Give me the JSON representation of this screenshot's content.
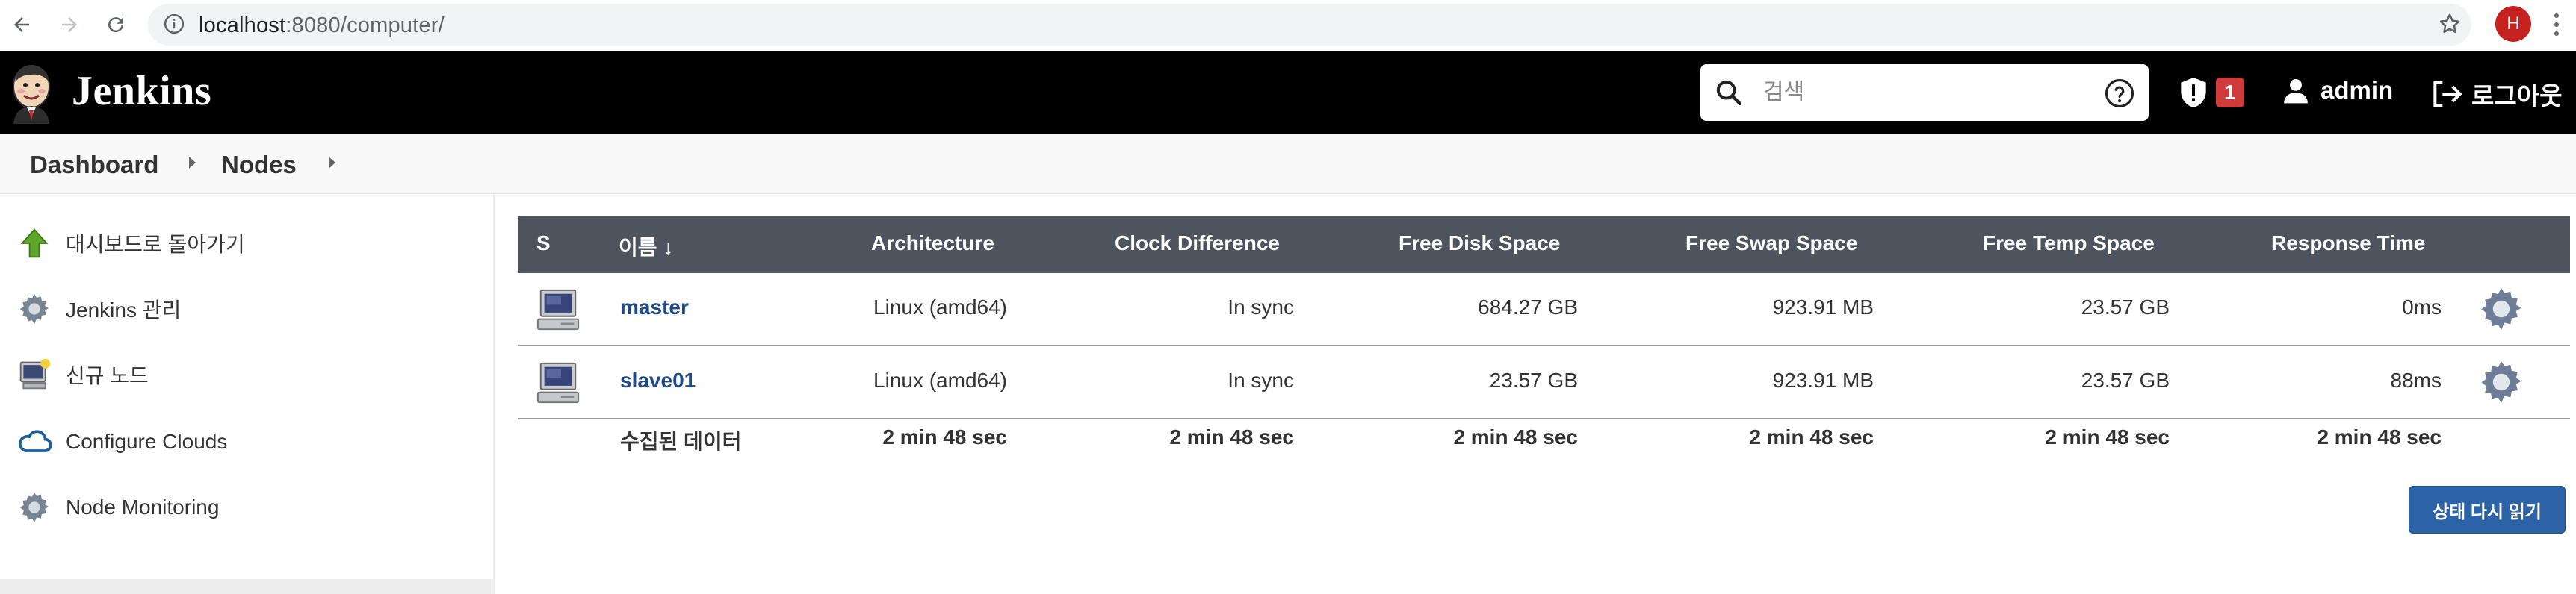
{
  "browser": {
    "url_host": "localhost",
    "url_path": ":8080/computer/",
    "profile_initial": "H"
  },
  "header": {
    "brand": "Jenkins",
    "search_placeholder": "검색",
    "alert_count": "1",
    "user": "admin",
    "logout": "로그아웃"
  },
  "breadcrumb": {
    "items": [
      "Dashboard",
      "Nodes"
    ]
  },
  "sidebar": {
    "items": [
      {
        "label": "대시보드로 돌아가기",
        "icon": "up-arrow-icon"
      },
      {
        "label": "Jenkins 관리",
        "icon": "gear-icon"
      },
      {
        "label": "신규 노드",
        "icon": "new-computer-icon"
      },
      {
        "label": "Configure Clouds",
        "icon": "cloud-icon"
      },
      {
        "label": "Node Monitoring",
        "icon": "gear-icon"
      }
    ]
  },
  "table": {
    "columns": [
      "S",
      "이름 ↓",
      "Architecture",
      "Clock Difference",
      "Free Disk Space",
      "Free Swap Space",
      "Free Temp Space",
      "Response Time"
    ],
    "rows": [
      {
        "name": "master",
        "arch": "Linux (amd64)",
        "clock": "In sync",
        "disk": "684.27 GB",
        "swap": "923.91 MB",
        "temp": "23.57 GB",
        "response": "0ms"
      },
      {
        "name": "slave01",
        "arch": "Linux (amd64)",
        "clock": "In sync",
        "disk": "23.57 GB",
        "swap": "923.91 MB",
        "temp": "23.57 GB",
        "response": "88ms"
      }
    ],
    "summary": {
      "label": "수집된 데이터",
      "arch": "2 min 48 sec",
      "clock": "2 min 48 sec",
      "disk": "2 min 48 sec",
      "swap": "2 min 48 sec",
      "temp": "2 min 48 sec",
      "response": "2 min 48 sec"
    }
  },
  "actions": {
    "refresh": "상태 다시 읽기"
  },
  "colors": {
    "header_bg": "#000000",
    "table_header_bg": "#4d545d",
    "link": "#204a87",
    "button": "#2b63a6",
    "badge": "#cf3a3a"
  }
}
